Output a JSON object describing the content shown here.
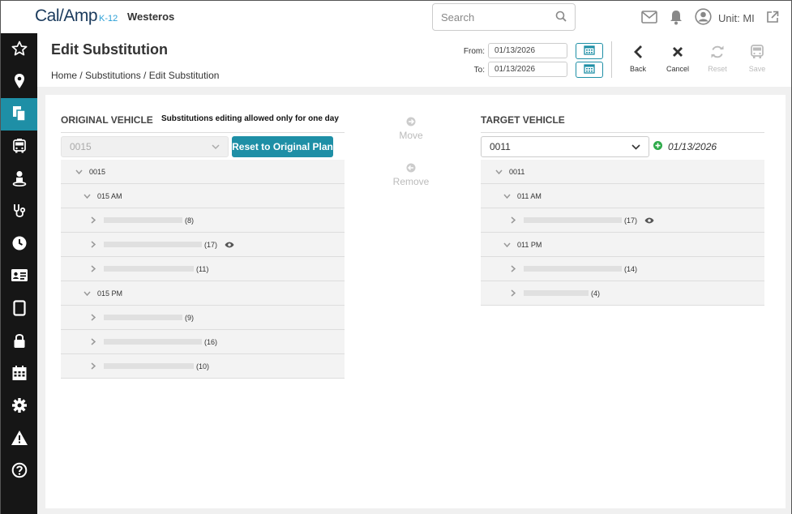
{
  "app": {
    "logo_text": "Cal/Amp",
    "logo_suffix": "K-12",
    "org_name": "Westeros"
  },
  "search": {
    "placeholder": "Search"
  },
  "user": {
    "unit_label": "Unit: MI"
  },
  "sidebar": {
    "items": [
      {
        "icon": "star-icon",
        "active": false
      },
      {
        "icon": "map-pin-icon",
        "active": false
      },
      {
        "icon": "copy-icon",
        "active": true
      },
      {
        "icon": "bus-icon",
        "active": false
      },
      {
        "icon": "person-icon",
        "active": false
      },
      {
        "icon": "stethoscope-icon",
        "active": false
      },
      {
        "icon": "clock-icon",
        "active": false
      },
      {
        "icon": "id-card-icon",
        "active": false
      },
      {
        "icon": "tablet-icon",
        "active": false
      },
      {
        "icon": "lock-icon",
        "active": false
      },
      {
        "icon": "calendar-icon",
        "active": false
      },
      {
        "icon": "gear-icon",
        "active": false
      },
      {
        "icon": "warning-icon",
        "active": false
      },
      {
        "icon": "help-icon",
        "active": false
      }
    ]
  },
  "header": {
    "title": "Edit Substitution",
    "breadcrumb": "Home / Substitutions / Edit Substitution",
    "from_label": "From:",
    "from_value": "01/13/2026",
    "to_label": "To:",
    "to_value": "01/13/2026",
    "actions": {
      "back": "Back",
      "cancel": "Cancel",
      "reset": "Reset",
      "save": "Save"
    }
  },
  "original": {
    "title": "ORIGINAL VEHICLE",
    "note": "Substitutions editing allowed only for one day",
    "select_value": "0015",
    "reset_button": "Reset to Original Plan",
    "rows": [
      {
        "level": 0,
        "label": "0015"
      },
      {
        "level": 1,
        "label": "015 AM"
      },
      {
        "level": 2,
        "count": "(8)",
        "bar": 97
      },
      {
        "level": 2,
        "count": "(17)",
        "bar": 121,
        "eye": true
      },
      {
        "level": 2,
        "count": "(11)",
        "bar": 111
      },
      {
        "level": 1,
        "label": "015 PM"
      },
      {
        "level": 2,
        "count": "(9)",
        "bar": 97
      },
      {
        "level": 2,
        "count": "(16)",
        "bar": 121
      },
      {
        "level": 2,
        "count": "(10)",
        "bar": 111
      }
    ]
  },
  "middle": {
    "move": "Move",
    "remove": "Remove"
  },
  "target": {
    "title": "TARGET VEHICLE",
    "select_value": "0011",
    "date": "01/13/2026",
    "rows": [
      {
        "level": 0,
        "label": "0011"
      },
      {
        "level": 1,
        "label": "011 AM"
      },
      {
        "level": 2,
        "count": "(17)",
        "bar": 121,
        "eye": true
      },
      {
        "level": 1,
        "label": "011 PM"
      },
      {
        "level": 2,
        "count": "(14)",
        "bar": 121
      },
      {
        "level": 2,
        "count": "(4)",
        "bar": 80
      }
    ]
  },
  "colors": {
    "accent": "#1e8fa6",
    "sidebar": "#161616",
    "add": "#2eaa4a"
  }
}
